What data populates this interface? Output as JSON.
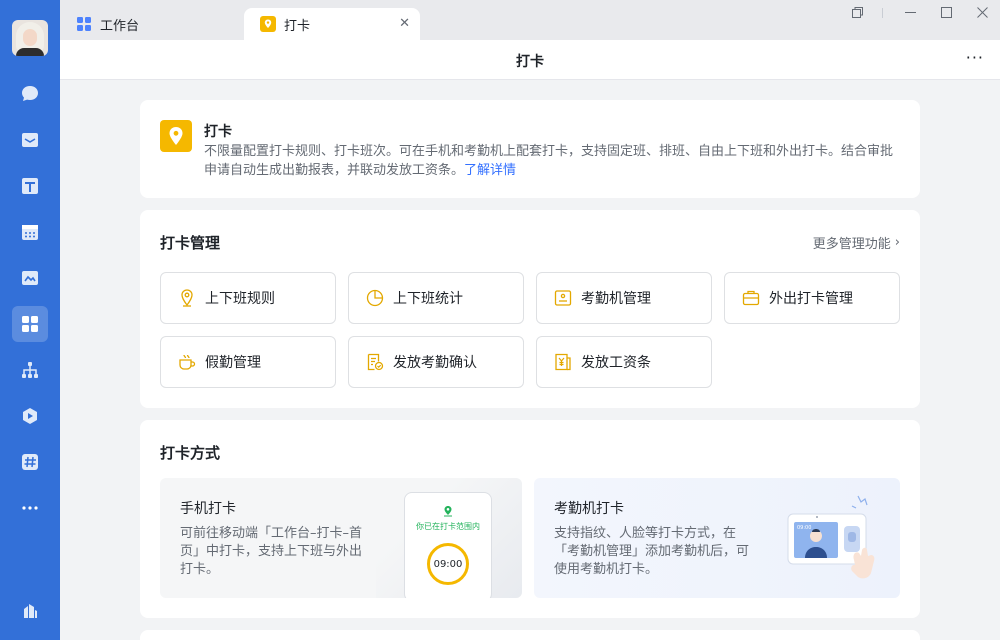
{
  "tabs": [
    {
      "label": "工作台",
      "icon": "grid-icon"
    },
    {
      "label": "打卡",
      "icon": "location-pin-icon",
      "active": true
    }
  ],
  "header": {
    "title": "打卡",
    "more": "···"
  },
  "intro": {
    "title": "打卡",
    "description": "不限量配置打卡规则、打卡班次。可在手机和考勤机上配套打卡，支持固定班、排班、自由上下班和外出打卡。结合审批申请自动生成出勤报表，并联动发放工资条。",
    "link": "了解详情"
  },
  "management": {
    "title": "打卡管理",
    "more_label": "更多管理功能",
    "items": [
      {
        "label": "上下班规则",
        "icon": "location-pin-icon"
      },
      {
        "label": "上下班统计",
        "icon": "pie-chart-icon"
      },
      {
        "label": "考勤机管理",
        "icon": "attendance-machine-icon"
      },
      {
        "label": "外出打卡管理",
        "icon": "briefcase-icon"
      },
      {
        "label": "假勤管理",
        "icon": "coffee-cup-icon"
      },
      {
        "label": "发放考勤确认",
        "icon": "document-check-icon"
      },
      {
        "label": "发放工资条",
        "icon": "payslip-icon"
      }
    ]
  },
  "methods": {
    "title": "打卡方式",
    "items": [
      {
        "title": "手机打卡",
        "description": "可前往移动端「工作台–打卡–首页」中打卡，支持上下班与外出打卡。",
        "preview_status": "你已在打卡范围内",
        "preview_time": "09:00"
      },
      {
        "title": "考勤机打卡",
        "description": "支持指纹、人脸等打卡方式，在「考勤机管理」添加考勤机后，可使用考勤机打卡。",
        "preview_time": "09:00"
      }
    ]
  },
  "colors": {
    "sidebar": "#3370d8",
    "accent": "#f5b800",
    "link": "#3370ff"
  }
}
